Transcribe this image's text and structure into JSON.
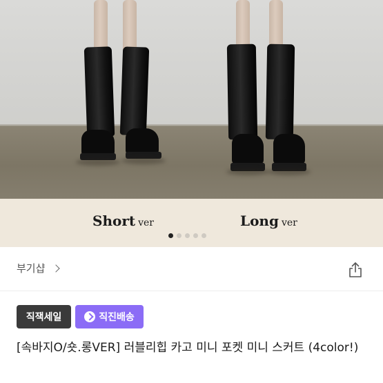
{
  "product_image": {
    "left_label_main": "Short",
    "left_label_sub": "ver",
    "right_label_main": "Long",
    "right_label_sub": "ver",
    "carousel_total": 5,
    "carousel_active": 1
  },
  "seller": {
    "name": "부기샵"
  },
  "badges": {
    "sale": "직잭세일",
    "shipping": "직진배송"
  },
  "product": {
    "title": "[속바지O/숏.롱VER] 러블리힙 카고 미니 포켓 미니 스커트 (4color!)"
  },
  "colors": {
    "shipping_badge": "#8b6cf6",
    "sale_badge": "#3a3a3a"
  },
  "icons": [
    "share-icon",
    "chevron-right-icon",
    "shipping-arrow-icon"
  ]
}
